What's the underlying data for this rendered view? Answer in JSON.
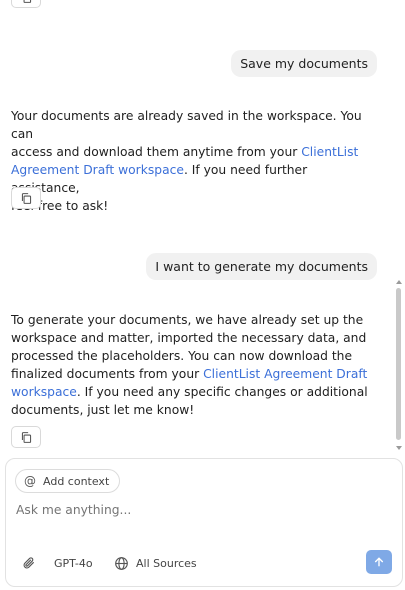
{
  "messages": [
    {
      "role": "user",
      "text": "Save my documents"
    },
    {
      "role": "assistant",
      "lines": [
        {
          "pre": "Your documents are already saved in the workspace. You can"
        },
        {
          "pre": "access and download them anytime from your ",
          "link": "ClientList"
        },
        {
          "link": "Agreement Draft workspace",
          "post": ". If you need further assistance,"
        },
        {
          "pre": "feel free to ask!"
        }
      ]
    },
    {
      "role": "user",
      "text": "I want to generate my documents"
    },
    {
      "role": "assistant",
      "lines": [
        {
          "pre": "To generate your documents, we have already set up the"
        },
        {
          "pre": "workspace and matter, imported the necessary data, and"
        },
        {
          "pre": "processed the placeholders. You can now download the"
        },
        {
          "pre": "finalized documents from your ",
          "link": "ClientList Agreement Draft"
        },
        {
          "link": "workspace",
          "post": ". If you need any specific changes or additional"
        },
        {
          "pre": "documents, just let me know!"
        }
      ]
    }
  ],
  "composer": {
    "context_label": "Add context",
    "placeholder": "Ask me anything...",
    "model_label": "GPT-4o",
    "sources_label": "All Sources"
  },
  "colors": {
    "link": "#3b6fd8",
    "send_button": "#7fa9e6",
    "user_bubble": "#f1f1f1"
  },
  "icons": [
    "copy-icon",
    "at-sign-icon",
    "paperclip-icon",
    "globe-icon",
    "arrow-up-icon"
  ]
}
